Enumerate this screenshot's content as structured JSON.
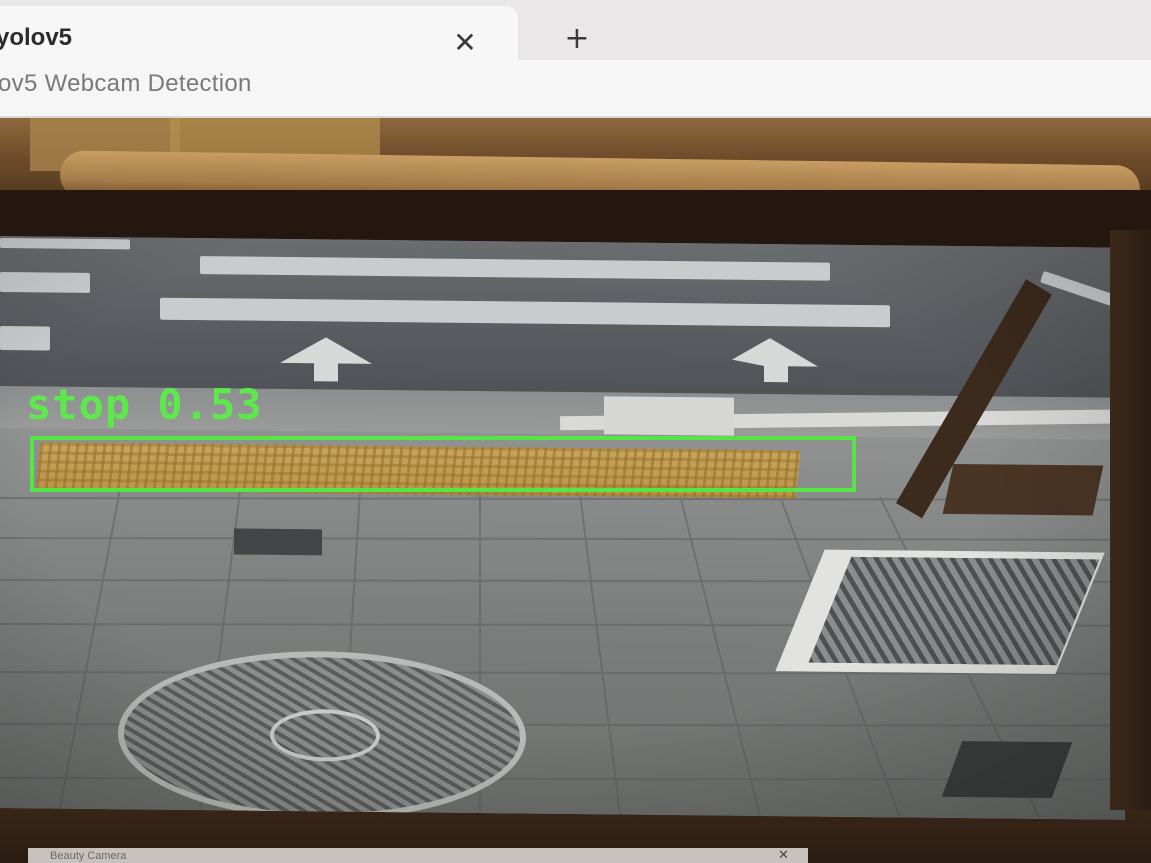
{
  "browser": {
    "tab_title": "yolov5",
    "tab_close_icon": "close-icon",
    "new_tab_icon": "plus-icon",
    "new_tab_glyph": "+",
    "close_glyph": "✕"
  },
  "page": {
    "heading": "ov5 Webcam Detection"
  },
  "detection": {
    "class_label": "stop",
    "confidence": "0.53",
    "label_text": "stop 0.53",
    "box_color": "#55e645"
  },
  "taskbar": {
    "window_label": "Beauty Camera",
    "close_glyph": "✕"
  },
  "colors": {
    "accent": "#55e645"
  }
}
